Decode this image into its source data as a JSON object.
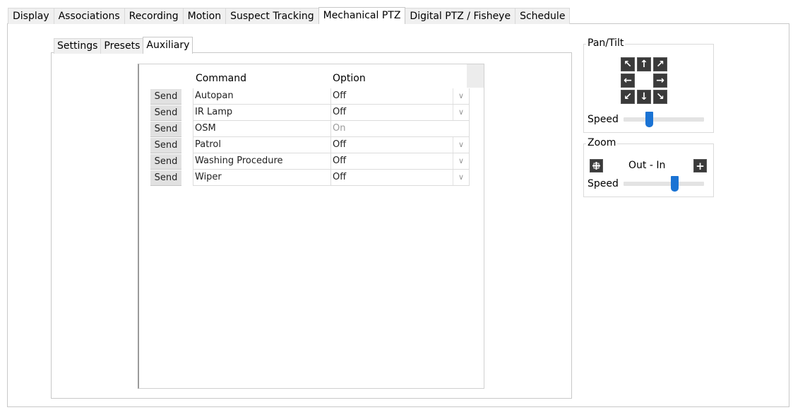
{
  "main_tabs": [
    {
      "label": "Display",
      "active": false
    },
    {
      "label": "Associations",
      "active": false
    },
    {
      "label": "Recording",
      "active": false
    },
    {
      "label": "Motion",
      "active": false
    },
    {
      "label": "Suspect Tracking",
      "active": false
    },
    {
      "label": "Mechanical PTZ",
      "active": true
    },
    {
      "label": "Digital PTZ / Fisheye",
      "active": false
    },
    {
      "label": "Schedule",
      "active": false
    }
  ],
  "sub_tabs": [
    {
      "label": "Settings",
      "active": false
    },
    {
      "label": "Presets",
      "active": false
    },
    {
      "label": "Auxiliary",
      "active": true
    }
  ],
  "grid": {
    "headers": {
      "command": "Command",
      "option": "Option"
    },
    "send_label": "Send",
    "rows": [
      {
        "command": "Autopan",
        "option": "Off",
        "has_dropdown": true
      },
      {
        "command": "IR Lamp",
        "option": "Off",
        "has_dropdown": true
      },
      {
        "command": "OSM",
        "option": "On",
        "has_dropdown": false
      },
      {
        "command": "Patrol",
        "option": "Off",
        "has_dropdown": true
      },
      {
        "command": "Washing Procedure",
        "option": "Off",
        "has_dropdown": true
      },
      {
        "command": "Wiper",
        "option": "Off",
        "has_dropdown": true
      }
    ]
  },
  "pan_tilt": {
    "title": "Pan/Tilt",
    "speed_label": "Speed",
    "speed_value": 0.3,
    "icons": [
      "arrow-up-left-icon",
      "arrow-up-icon",
      "arrow-up-right-icon",
      "arrow-left-icon",
      "arrow-right-icon",
      "arrow-down-left-icon",
      "arrow-down-icon",
      "arrow-down-right-icon"
    ]
  },
  "zoom": {
    "title": "Zoom",
    "range_label": "Out - In",
    "speed_label": "Speed",
    "speed_value": 0.65,
    "icons": [
      "zoom-out-icon",
      "zoom-in-icon"
    ]
  },
  "colors": {
    "accent": "#1a73d4",
    "button_dark": "#3a3a3a",
    "tab_inactive": "#f0f0f0"
  }
}
